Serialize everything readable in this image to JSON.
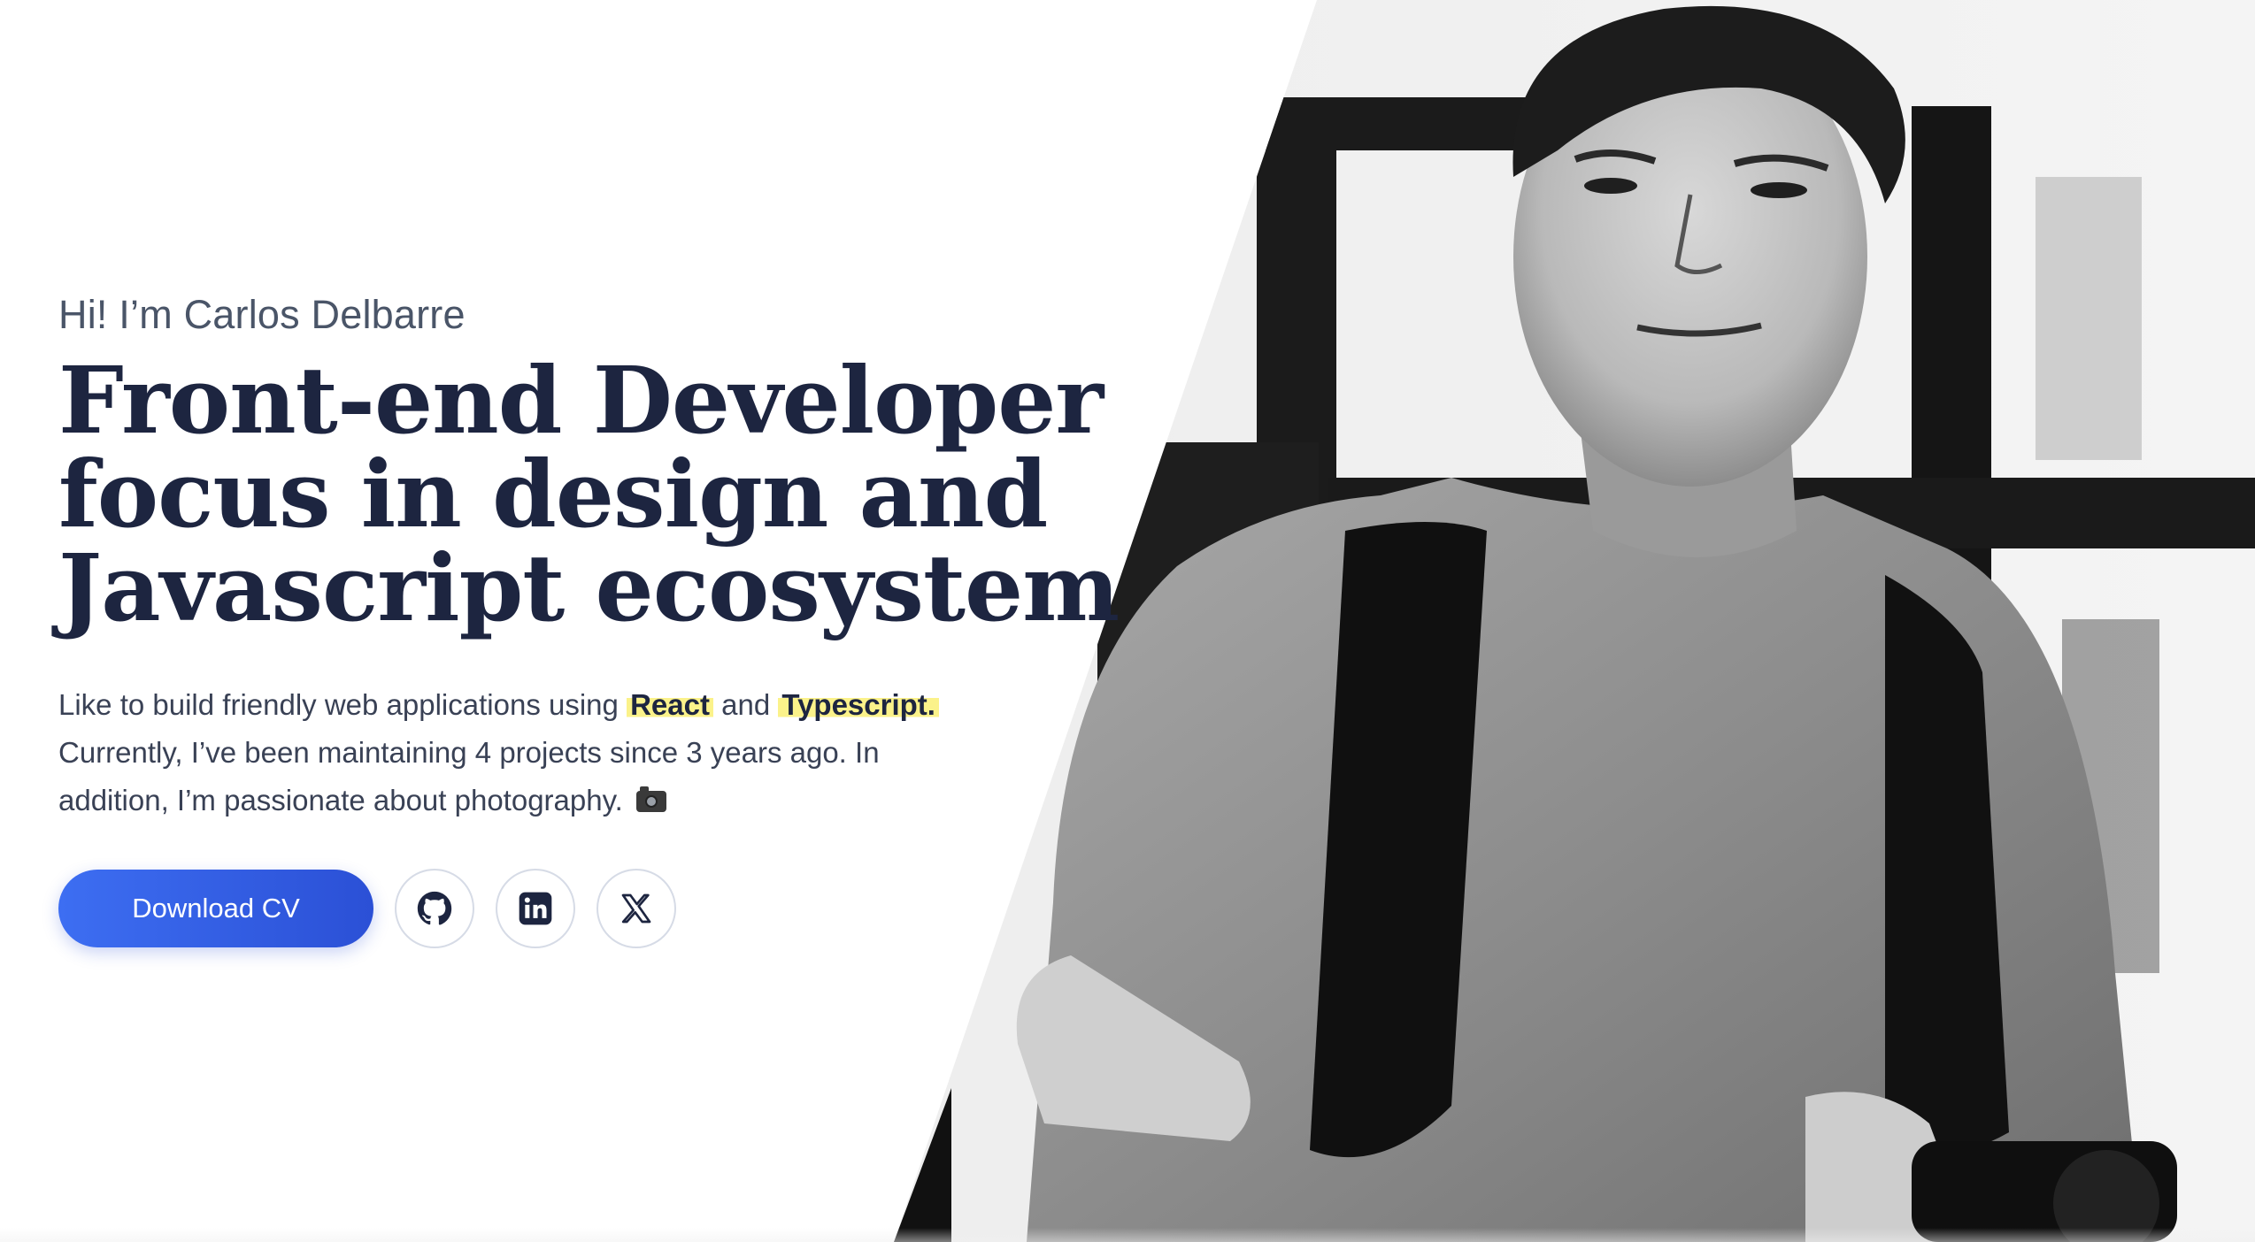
{
  "hero": {
    "greeting": "Hi! I’m Carlos Delbarre",
    "headline": [
      "Front-end Developer",
      "focus in design and",
      "Javascript ecosystem"
    ],
    "bio": {
      "part1": "Like to build friendly web applications using",
      "highlight1": "React",
      "part2": "and",
      "highlight2": "Typescript.",
      "part3": "Currently, I’ve been maintaining 4 projects since 3 years ago. In addition, I’m passionate about photography."
    }
  },
  "actions": {
    "download_label": "Download CV",
    "social": [
      {
        "icon": "github-icon"
      },
      {
        "icon": "linkedin-icon"
      },
      {
        "icon": "x-twitter-icon"
      }
    ]
  },
  "colors": {
    "primary": "#3d6ef2",
    "highlight": "#fbf28a",
    "heading": "#1d2540"
  }
}
